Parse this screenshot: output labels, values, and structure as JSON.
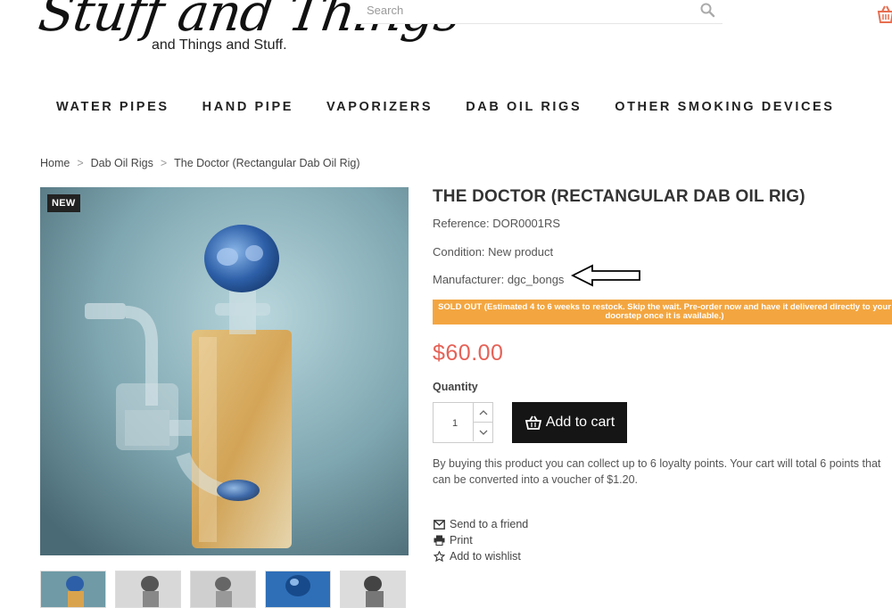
{
  "header": {
    "logo_script": "Stuff and Things",
    "logo_tagline": "and Things and Stuff.",
    "search_placeholder": "Search"
  },
  "nav": {
    "items": [
      "WATER PIPES",
      "HAND PIPE",
      "VAPORIZERS",
      "DAB OIL RIGS",
      "OTHER SMOKING DEVICES"
    ]
  },
  "breadcrumb": {
    "home": "Home",
    "category": "Dab Oil Rigs",
    "current": "The Doctor (Rectangular Dab Oil Rig)",
    "separator": ">"
  },
  "product": {
    "badge": "NEW",
    "title": "THE DOCTOR (RECTANGULAR DAB OIL RIG)",
    "reference": "Reference: DOR0001RS",
    "condition": "Condition: New product",
    "manufacturer": "Manufacturer: dgc_bongs",
    "stock_notice": "SOLD OUT (Estimated 4 to 6 weeks to restock. Skip the wait. Pre-order now and have it delivered directly to your doorstep once it is available.)",
    "price": "$60.00",
    "quantity_label": "Quantity",
    "quantity_value": "1",
    "add_to_cart": "Add to cart",
    "loyalty_text": "By buying this product you can collect up to 6 loyalty points. Your cart will total 6 points that can be converted into a voucher of $1.20."
  },
  "actions": {
    "send": "Send to a friend",
    "print": "Print",
    "wishlist": "Add to wishlist"
  },
  "colors": {
    "accent_price": "#e66156",
    "stock_banner": "#f3a640",
    "button_dark": "#151515",
    "cart_icon": "#e76f51"
  }
}
